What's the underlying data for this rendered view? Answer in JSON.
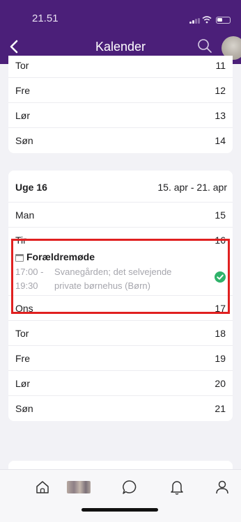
{
  "status_bar": {
    "time": "21.51"
  },
  "header": {
    "title": "Kalender"
  },
  "week15_partial": {
    "rows": [
      {
        "day": "Tor",
        "num": "11"
      },
      {
        "day": "Fre",
        "num": "12"
      },
      {
        "day": "Lør",
        "num": "13"
      },
      {
        "day": "Søn",
        "num": "14"
      }
    ]
  },
  "week16": {
    "label": "Uge 16",
    "range": "15. apr - 21. apr",
    "rows_before": [
      {
        "day": "Man",
        "num": "15"
      }
    ],
    "event_day": {
      "day": "Tir",
      "num": "16",
      "event": {
        "title": "Forældremøde",
        "start": "17:00 -",
        "end": "19:30",
        "location_line1": "Svanegården; det selvejende",
        "location_line2": "private børnehus (Børn)",
        "status_color": "#2fb26a"
      }
    },
    "rows_after": [
      {
        "day": "Ons",
        "num": "17"
      },
      {
        "day": "Tor",
        "num": "18"
      },
      {
        "day": "Fre",
        "num": "19"
      },
      {
        "day": "Lør",
        "num": "20"
      },
      {
        "day": "Søn",
        "num": "21"
      }
    ]
  },
  "tab_bar": {
    "tabs": [
      "home-icon",
      "photo-thumbnail",
      "chat-icon",
      "bell-icon",
      "profile-icon"
    ]
  },
  "colors": {
    "header_bg": "#4b1f79",
    "highlight": "#e02020",
    "accept": "#2fb26a"
  }
}
